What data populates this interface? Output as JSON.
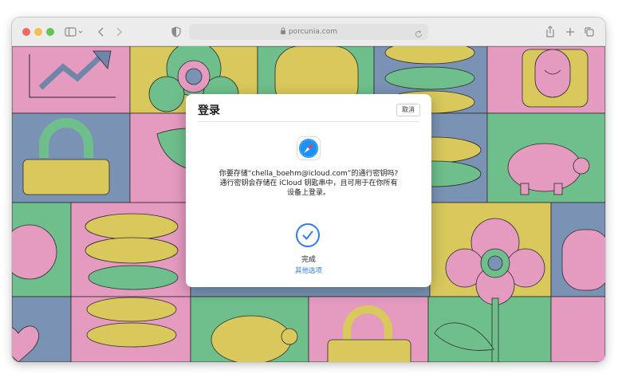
{
  "browser": {
    "url": "porcunia.com",
    "icons": {
      "traffic_lights": [
        "#ec6a5e",
        "#f4be4f",
        "#61c554"
      ],
      "sidebar": "sidebar-icon",
      "back": "chevron-left-icon",
      "forward": "chevron-right-icon",
      "privacy": "shield-icon",
      "lock": "lock-icon",
      "reload": "reload-icon",
      "share": "share-icon",
      "new_tab": "plus-icon",
      "tabs": "tab-overview-icon"
    }
  },
  "dialog": {
    "title": "登录",
    "cancel_label": "取消",
    "message_line1": "你要存储“chella_boehm@icloud.com”的通行密钥吗?",
    "message_line2": "通行密钥会存储在 iCloud 钥匙串中，且可用于在你所有",
    "message_line3": "设备上登录。",
    "done_label": "完成",
    "other_options_label": "其他选项",
    "accent_color": "#2f7cf0"
  }
}
